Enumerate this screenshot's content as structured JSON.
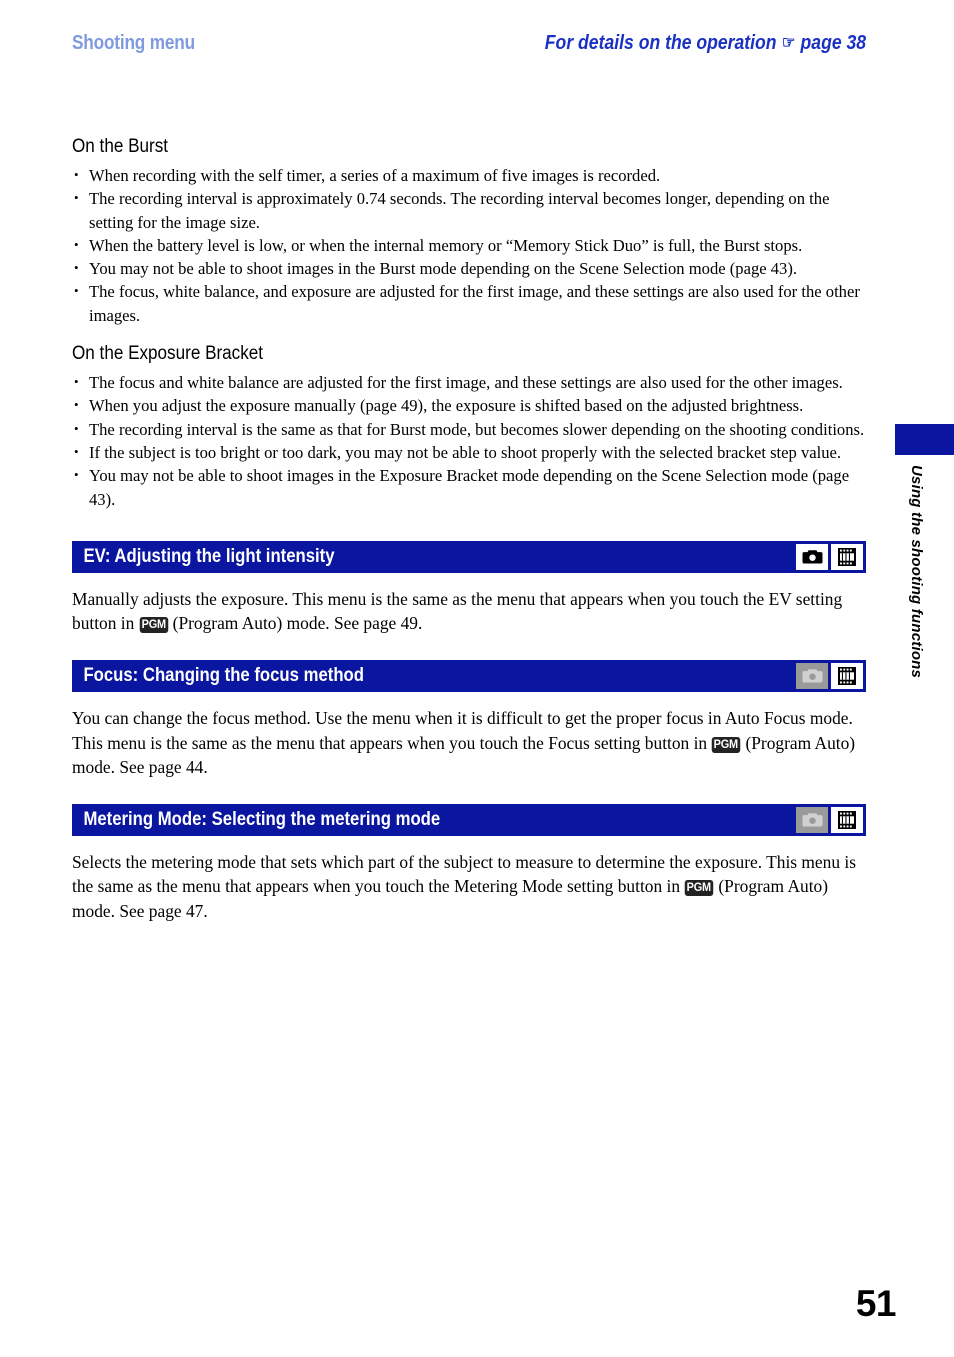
{
  "header": {
    "left_title": "Shooting menu",
    "right_title": "For details on the operation",
    "hand_icon": "pointing-hand-icon",
    "right_page_ref": "page 38",
    "left_color": "#7f9ade",
    "right_color": "#1a31c4"
  },
  "sections": [
    {
      "heading": "On the Burst",
      "bullets": [
        "When recording with the self timer, a series of a maximum of five images is recorded.",
        "The recording interval is approximately 0.74 seconds. The recording interval becomes longer, depending on the setting for the image size.",
        "When the battery level is low, or when the internal memory or “Memory Stick Duo” is full, the Burst stops.",
        "You may not be able to shoot images in the Burst mode depending on the Scene Selection mode (page 43).",
        "The focus, white balance, and exposure are adjusted for the first image, and these settings are also used for the other images."
      ]
    },
    {
      "heading": "On the Exposure Bracket",
      "bullets": [
        "The focus and white balance are adjusted for the first image, and these settings are also used for the other images.",
        "When you adjust the exposure manually (page 49), the exposure is shifted based on the adjusted brightness.",
        "The recording interval is the same as that for Burst mode, but becomes slower depending on the shooting conditions.",
        "If the subject is too bright or too dark, you may not be able to shoot properly with the selected bracket step value.",
        "You may not be able to shoot images in the Exposure Bracket mode depending on the Scene Selection mode (page 43)."
      ]
    }
  ],
  "menu_items": [
    {
      "bar_title": "EV: Adjusting the light intensity",
      "camera_icon": "still-camera-icon",
      "camera_enabled": true,
      "movie_icon": "movie-film-icon",
      "movie_enabled": true,
      "body_part1": "Manually adjusts the exposure. This menu is the same as the menu that appears when you touch the EV setting button in",
      "mode_badge": "PGM",
      "body_part2": "(Program Auto) mode. See page 49."
    },
    {
      "bar_title": "Focus: Changing the focus method",
      "camera_icon": "still-camera-icon",
      "camera_enabled": false,
      "movie_icon": "movie-film-icon",
      "movie_enabled": true,
      "body_part1": "You can change the focus method. Use the menu when it is difficult to get the proper focus in Auto Focus mode. This menu is the same as the menu that appears when you touch the Focus setting button in",
      "mode_badge": "PGM",
      "body_part2": "(Program Auto) mode. See page 44."
    },
    {
      "bar_title": "Metering Mode: Selecting the metering mode",
      "camera_icon": "still-camera-icon",
      "camera_enabled": false,
      "movie_icon": "movie-film-icon",
      "movie_enabled": true,
      "body_part1": "Selects the metering mode that sets which part of the subject to measure to determine the exposure. This menu is the same as the menu that appears when you touch the Metering Mode setting button in",
      "mode_badge": "PGM",
      "body_part2": "(Program Auto) mode. See page 47."
    }
  ],
  "side_tab": {
    "label": "Using the shooting functions",
    "tab_color": "#0a15a0"
  },
  "page_number": "51",
  "bar_color": "#0a15a0"
}
